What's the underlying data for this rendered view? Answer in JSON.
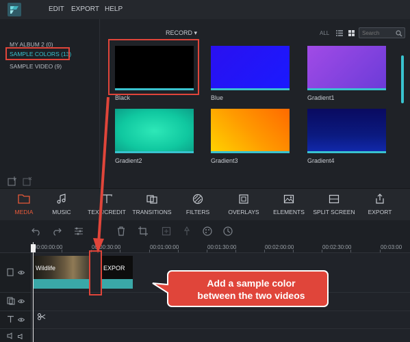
{
  "menubar": {
    "items": [
      "EDIT",
      "EXPORT",
      "HELP"
    ]
  },
  "library": {
    "items": [
      {
        "label": "MY ALBUM 2 (0)"
      },
      {
        "label": "SAMPLE COLORS (13)"
      },
      {
        "label": "SAMPLE VIDEO (9)"
      }
    ]
  },
  "browser": {
    "dropdown": "RECORD",
    "view_all": "ALL",
    "search_placeholder": "Search",
    "tiles": [
      {
        "label": "Black",
        "color": "#000000"
      },
      {
        "label": "Blue",
        "color": "#1a1aff"
      },
      {
        "label": "Gradient1",
        "color": "#8a45e0"
      },
      {
        "label": "Gradient2",
        "color": "#1ee0b0"
      },
      {
        "label": "Gradient3",
        "color": "#ff9a00"
      },
      {
        "label": "Gradient4",
        "color": "#0b1a80"
      },
      {
        "label": "",
        "color": "#12a040"
      },
      {
        "label": "",
        "color": "#7a1ab0"
      },
      {
        "label": "",
        "color": "#b01010"
      }
    ]
  },
  "tabs": [
    "MEDIA",
    "MUSIC",
    "TEXT/CREDIT",
    "TRANSITIONS",
    "FILTERS",
    "OVERLAYS",
    "ELEMENTS",
    "SPLIT SCREEN",
    "EXPORT"
  ],
  "ruler": [
    "00:00:00:00",
    "00:00:30:00",
    "00:01:00:00",
    "00:01:30:00",
    "00:02:00:00",
    "00:02:30:00",
    "00:03:00"
  ],
  "clips": {
    "first": "Wildlife",
    "second": "EXPOR"
  },
  "annotation": {
    "line1": "Add a sample color",
    "line2": "between the two videos"
  },
  "colors": {
    "accent": "#39c3cf",
    "highlight": "#e0453a",
    "active_tab": "#e85a3a"
  }
}
